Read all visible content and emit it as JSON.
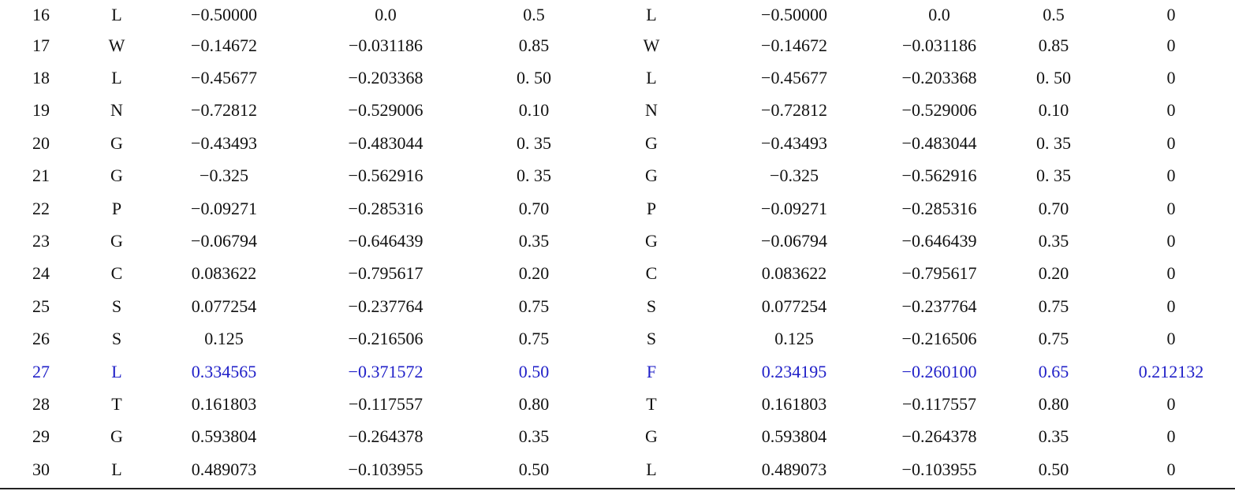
{
  "table": {
    "rows": [
      [
        "16",
        "L",
        "−0.50000",
        "0.0",
        "0.5",
        "L",
        "−0.50000",
        "0.0",
        "0.5",
        "0"
      ],
      [
        "17",
        "W",
        "−0.14672",
        "−0.031186",
        "0.85",
        "W",
        "−0.14672",
        "−0.031186",
        "0.85",
        "0"
      ],
      [
        "18",
        "L",
        "−0.45677",
        "−0.203368",
        "0. 50",
        "L",
        "−0.45677",
        "−0.203368",
        "0. 50",
        "0"
      ],
      [
        "19",
        "N",
        "−0.72812",
        "−0.529006",
        "0.10",
        "N",
        "−0.72812",
        "−0.529006",
        "0.10",
        "0"
      ],
      [
        "20",
        "G",
        "−0.43493",
        "−0.483044",
        "0. 35",
        "G",
        "−0.43493",
        "−0.483044",
        "0. 35",
        "0"
      ],
      [
        "21",
        "G",
        "−0.325",
        "−0.562916",
        "0. 35",
        "G",
        "−0.325",
        "−0.562916",
        "0. 35",
        "0"
      ],
      [
        "22",
        "P",
        "−0.09271",
        "−0.285316",
        "0.70",
        "P",
        "−0.09271",
        "−0.285316",
        "0.70",
        "0"
      ],
      [
        "23",
        "G",
        "−0.06794",
        "−0.646439",
        "0.35",
        "G",
        "−0.06794",
        "−0.646439",
        "0.35",
        "0"
      ],
      [
        "24",
        "C",
        "0.083622",
        "−0.795617",
        "0.20",
        "C",
        "0.083622",
        "−0.795617",
        "0.20",
        "0"
      ],
      [
        "25",
        "S",
        "0.077254",
        "−0.237764",
        "0.75",
        "S",
        "0.077254",
        "−0.237764",
        "0.75",
        "0"
      ],
      [
        "26",
        "S",
        "0.125",
        "−0.216506",
        "0.75",
        "S",
        "0.125",
        "−0.216506",
        "0.75",
        "0"
      ],
      [
        "27",
        "L",
        "0.334565",
        "−0.371572",
        "0.50",
        "F",
        "0.234195",
        "−0.260100",
        "0.65",
        "0.212132"
      ],
      [
        "28",
        "T",
        "0.161803",
        "−0.117557",
        "0.80",
        "T",
        "0.161803",
        "−0.117557",
        "0.80",
        "0"
      ],
      [
        "29",
        "G",
        "0.593804",
        "−0.264378",
        "0.35",
        "G",
        "0.593804",
        "−0.264378",
        "0.35",
        "0"
      ],
      [
        "30",
        "L",
        "0.489073",
        "−0.103955",
        "0.50",
        "L",
        "0.489073",
        "−0.103955",
        "0.50",
        "0"
      ]
    ],
    "highlight_row": 11,
    "highlight_color": "#2020c8"
  }
}
